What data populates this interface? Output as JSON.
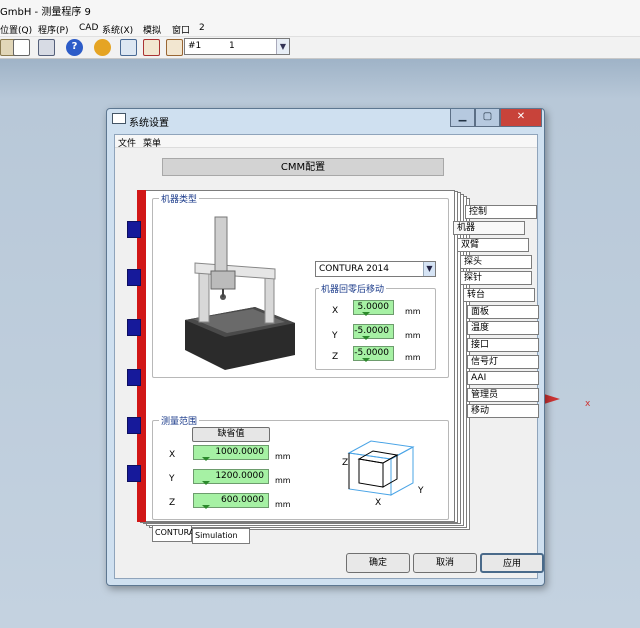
{
  "app": {
    "title": "GmbH - 测量程序 9",
    "menu": [
      "位置(Q)",
      "程序(P)",
      "CAD",
      "系统(X)",
      "模拟",
      "窗口",
      "2"
    ],
    "toolbar_combo": {
      "value": "#1",
      "second": "1"
    }
  },
  "dialog": {
    "title": "系统设置",
    "menu": [
      "文件",
      "菜单"
    ],
    "header": "CMM配置",
    "machine_type": {
      "label": "机器类型",
      "model": "CONTURA 2014"
    },
    "home_offset": {
      "label": "机器回零后移动",
      "rows": [
        {
          "axis": "X",
          "value": "5.0000",
          "unit": "mm"
        },
        {
          "axis": "Y",
          "value": "-5.0000",
          "unit": "mm"
        },
        {
          "axis": "Z",
          "value": "-5.0000",
          "unit": "mm"
        }
      ]
    },
    "measure_range": {
      "label": "测量范围",
      "defaults_button": "缺省值",
      "rows": [
        {
          "axis": "X",
          "value": "1000.0000",
          "unit": "mm"
        },
        {
          "axis": "Y",
          "value": "1200.0000",
          "unit": "mm"
        },
        {
          "axis": "Z",
          "value": "600.0000",
          "unit": "mm"
        }
      ],
      "diagram_labels": {
        "x": "X",
        "y": "Y",
        "z": "Z"
      }
    },
    "right_tabs": [
      "控制",
      "机器",
      "双臂",
      "探头",
      "探针",
      "转台",
      "面板",
      "温度",
      "接口",
      "信号灯",
      "AAI",
      "管理员",
      "移动"
    ],
    "bottom_tabs": [
      "CONTURA",
      "Simulation"
    ],
    "buttons": {
      "ok": "确定",
      "cancel": "取消",
      "apply": "应用"
    }
  },
  "workspace": {
    "marker_label": "x"
  },
  "colors": {
    "accent_red": "#d11717",
    "block_blue": "#16199a",
    "entry_green": "#a6f1a4",
    "title_close": "#c8433a"
  }
}
